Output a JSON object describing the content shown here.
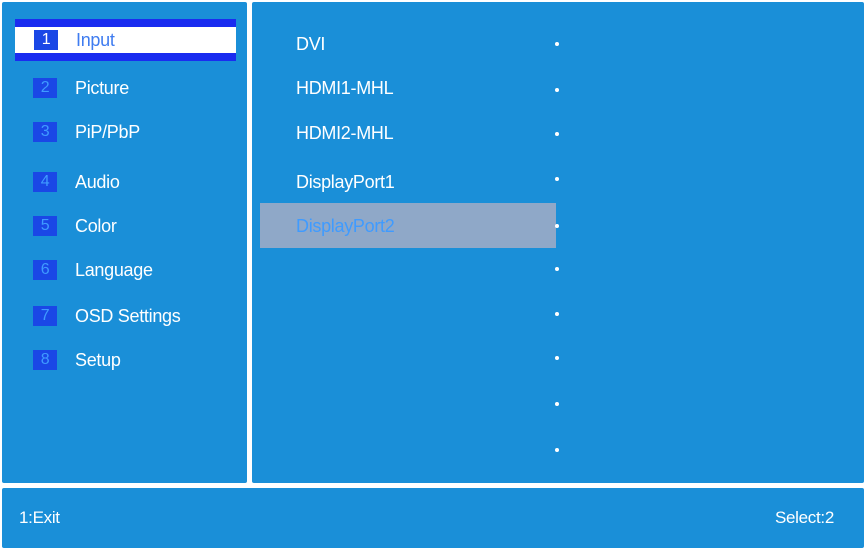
{
  "menu": {
    "items": [
      {
        "num": "1",
        "label": "Input"
      },
      {
        "num": "2",
        "label": "Picture"
      },
      {
        "num": "3",
        "label": "PiP/PbP"
      },
      {
        "num": "4",
        "label": "Audio"
      },
      {
        "num": "5",
        "label": "Color"
      },
      {
        "num": "6",
        "label": "Language"
      },
      {
        "num": "7",
        "label": "OSD Settings"
      },
      {
        "num": "8",
        "label": "Setup"
      }
    ],
    "selected_index": 0
  },
  "input_options": {
    "items": [
      {
        "label": "DVI"
      },
      {
        "label": "HDMI1-MHL"
      },
      {
        "label": "HDMI2-MHL"
      },
      {
        "label": "DisplayPort1"
      },
      {
        "label": "DisplayPort2"
      }
    ],
    "highlighted_index": 4,
    "value_dots_count": 10
  },
  "footer": {
    "left": "1:Exit",
    "right": "Select:2"
  },
  "colors": {
    "panel": "#1a8fd8",
    "selected_border": "#1a2cf0",
    "number_box": "#1a47e6",
    "highlight_row": "#8fa8c8"
  }
}
